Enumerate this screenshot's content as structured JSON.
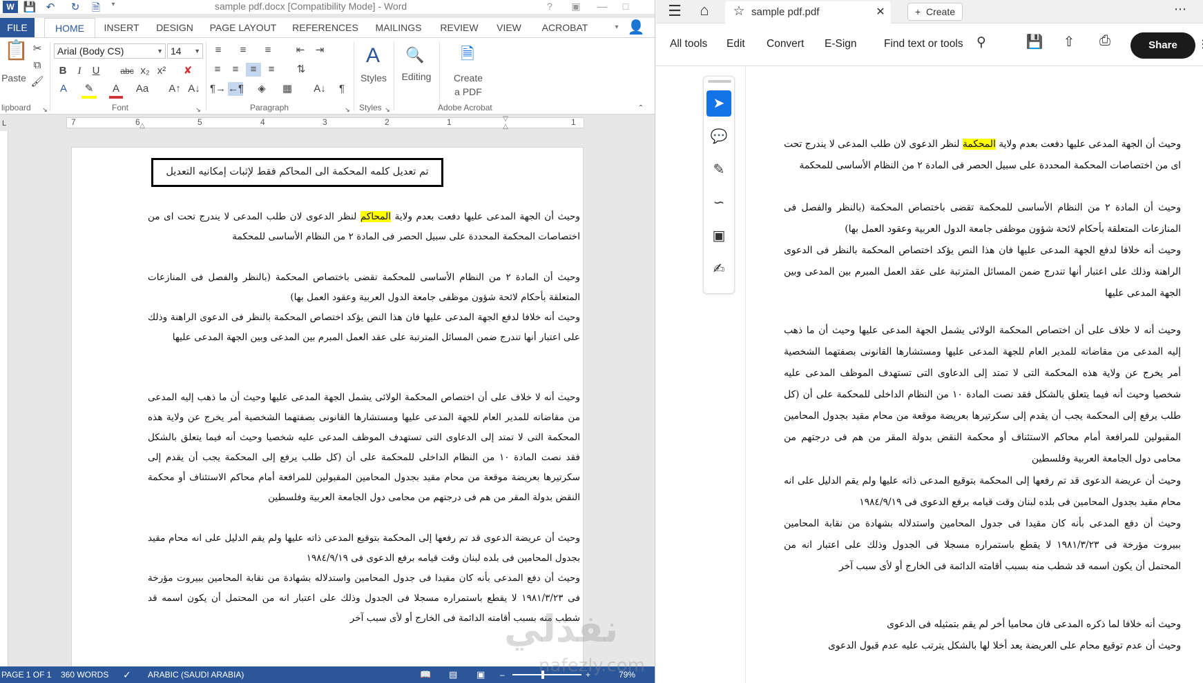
{
  "word": {
    "title": "sample pdf.docx [Compatibility Mode] - Word",
    "tabs": [
      "FILE",
      "HOME",
      "INSERT",
      "DESIGN",
      "PAGE LAYOUT",
      "REFERENCES",
      "MAILINGS",
      "REVIEW",
      "VIEW",
      "ACROBAT"
    ],
    "active_tab": "HOME",
    "ribbon": {
      "clipboard_label": "lipboard",
      "paste_label": "Paste",
      "font_label": "Font",
      "font_name": "Arial (Body CS)",
      "font_size": "14",
      "paragraph_label": "Paragraph",
      "styles_label": "Styles",
      "styles_button": "Styles",
      "editing_button": "Editing",
      "create_pdf_line1": "Create",
      "create_pdf_line2": "a PDF",
      "adobe_acrobat_label": "Adobe Acrobat"
    },
    "ruler_numbers": [
      "7",
      "6",
      "5",
      "4",
      "3",
      "2",
      "1",
      "1"
    ],
    "boxed_note": "تم تعديل كلمه المحكمة الى المحاكم فقط لإثبات إمكانيه التعديل",
    "paragraphs": [
      {
        "pre": "وحيث أن الجهة المدعى عليها دفعت بعدم ولاية ",
        "hl": "المحاكم",
        "post": " لنظر الدعوى لان طلب المدعى لا يندرج تحت اى من اختصاصات المحكمة المحددة على سبيل الحصر فى المادة ٢ من النظام الأساسى للمحكمة"
      },
      {
        "text": "وحيث أن المادة ٢ من النظام الأساسى للمحكمة تقضى باختصاص المحكمة (بالنظر والفصل فى المنازعات المتعلقة بأحكام لائحة شؤون موظفى جامعة الدول العربية وعقود العمل بها)"
      },
      {
        "text": "وحيث أنه خلافا لدفع الجهة المدعى عليها فان هذا النص يؤكد اختصاص المحكمة بالنظر فى الدعوى الراهنة وذلك على اعتبار أنها تندرج ضمن المسائل المترتبة على عقد العمل المبرم بين المدعى وبين الجهة المدعى عليها"
      },
      {
        "text": "وحيث أنه لا خلاف على أن اختصاص المحكمة الولائى يشمل الجهة المدعى عليها وحيث أن ما ذهب إليه المدعى من مقاضاته للمدير العام للجهة المدعى عليها ومستشارها القانونى بصفتهما الشخصية أمر يخرج عن ولاية هذه المحكمة التى لا تمتد إلى الدعاوى التى تستهدف الموظف المدعى عليه شخصيا وحيث أنه فيما يتعلق بالشكل فقد نصت المادة ١٠ من النظام الداخلى للمحكمة على أن (كل طلب يرفع إلى المحكمة يجب أن يقدم إلى سكرتيرها بعريضة موقعة من محام مقيد بجدول المحامين المقبولين للمرافعة أمام محاكم الاستئناف أو محكمة النقض بدولة المقر من هم فى درجتهم من محامى دول الجامعة العربية وفلسطين"
      },
      {
        "text": "وحيث أن عريضة الدعوى قد تم رفعها إلى المحكمة بتوقيع المدعى ذاته عليها ولم يقم الدليل على انه محام مقيد بجدول المحامين فى بلده لبنان وقت قيامه برفع الدعوى فى ١٩٨٤/٩/١٩"
      },
      {
        "text": "وحيث أن دفع المدعى بأنه كان مقيدا فى جدول المحامين واستدلاله بشهادة من نقابة المحامين ببيروت مؤرخة فى ١٩٨١/٣/٢٣ لا يقطع باستمراره مسجلا فى الجدول وذلك على اعتبار انه من المحتمل أن يكون اسمه قد شطب منه بسبب أقامته الدائمة فى الخارج أو لأى سبب آخر"
      }
    ],
    "status": {
      "page": "PAGE 1 OF 1",
      "words": "360 WORDS",
      "language": "ARABIC (SAUDI ARABIA)",
      "zoom": "79%"
    }
  },
  "pdf": {
    "tab_title": "sample pdf.pdf",
    "create_label": "Create",
    "menu": [
      "All tools",
      "Edit",
      "Convert",
      "E-Sign"
    ],
    "find_label": "Find text or tools",
    "share_label": "Share",
    "paragraphs": [
      {
        "pre": "وحيث أن الجهة المدعى عليها دفعت بعدم ولاية ",
        "hl": "المحكمة",
        "post": " لنظر الدعوى لان طلب المدعى لا يندرج تحت اى من اختصاصات المحكمة المحددة على سبيل الحصر فى المادة ٢ من النظام الأساسى للمحكمة"
      },
      {
        "text": "وحيث أن المادة ٢ من النظام الأساسى للمحكمة تقضى باختصاص المحكمة (بالنظر والفصل فى المنازعات المتعلقة بأحكام لائحة شؤون موظفى جامعة الدول العربية وعقود العمل بها)"
      },
      {
        "text": "وحيث أنه خلافا لدفع الجهة المدعى عليها فان هذا النص يؤكد اختصاص المحكمة بالنظر فى الدعوى الراهنة وذلك على اعتبار أنها تندرج ضمن المسائل المترتبة على عقد العمل المبرم بين المدعى وبين الجهة المدعى عليها"
      },
      {
        "text": "وحيث أنه لا خلاف على أن اختصاص المحكمة الولائى يشمل الجهة المدعى عليها وحيث أن ما ذهب إليه المدعى من مقاضاته للمدير العام للجهة المدعى عليها ومستشارها القانونى بصفتهما الشخصية أمر يخرج عن ولاية هذه المحكمة التى لا تمتد إلى الدعاوى التى تستهدف الموظف المدعى عليه شخصيا وحيث أنه فيما يتعلق بالشكل فقد نصت المادة ١٠ من النظام الداخلى للمحكمة على أن (كل طلب يرفع إلى المحكمة يجب أن يقدم إلى سكرتيرها بعريضة موقعة من محام مقيد بجدول المحامين المقبولين للمرافعة أمام محاكم الاستئناف أو محكمة النقض بدولة المقر من هم فى درجتهم من محامى دول الجامعة العربية وفلسطين"
      },
      {
        "text": "وحيث أن عريضة الدعوى قد تم رفعها إلى المحكمة بتوقيع المدعى ذاته عليها ولم يقم الدليل على انه محام مقيد بجدول المحامين فى بلده لبنان وقت قيامه برفع الدعوى فى ١٩٨٤/٩/١٩"
      },
      {
        "text": "وحيث أن دفع المدعى بأنه كان مقيدا فى جدول المحامين واستدلاله بشهادة من نقابة المحامين ببيروت مؤرخة فى ١٩٨١/٣/٢٣ لا يقطع باستمراره مسجلا فى الجدول وذلك على اعتبار انه من المحتمل أن يكون اسمه قد شطب منه بسبب أقامته الدائمة فى الخارج أو لأى سبب آخر"
      },
      {
        "text": "وحيث أنه خلافا لما ذكره المدعى فان محاميا أخر لم يقم بتمثيله فى الدعوى"
      },
      {
        "text": "وحيث أن عدم توقيع محام على العريضة يعد أخلا لها بالشكل يترتب عليه عدم قبول الدعوى"
      }
    ]
  },
  "watermark": {
    "arabic": "نفذلي",
    "latin": "nafezly.com"
  }
}
